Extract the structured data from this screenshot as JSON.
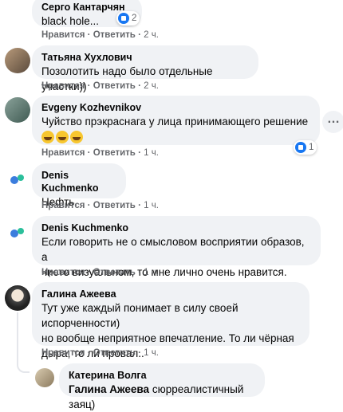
{
  "labels": {
    "like": "Нравится",
    "reply": "Ответить",
    "sep": "·"
  },
  "comments": [
    {
      "author": "Серго Кантарчян",
      "text": "black hole...",
      "time": "2 ч.",
      "reaction_count": "2"
    },
    {
      "author": "Татьяна Хухлович",
      "text": "Позолотить надо было отдельные участки))",
      "time": "2 ч."
    },
    {
      "author": "Evgeny Kozhevnikov",
      "text": "Чуйство прэкраснага у лица принимающего решение",
      "emoji": [
        "laughing-emoji",
        "laughing-emoji",
        "laughing-emoji"
      ],
      "time": "1 ч.",
      "reaction_count": "1"
    },
    {
      "author": "Denis Kuchmenko",
      "text": "Нефть.",
      "time": "1 ч."
    },
    {
      "author": "Denis Kuchmenko",
      "text_lines": [
        "Если говорить не о смысловом восприятии образов, а",
        "чисто визуальном, то мне лично очень нравится."
      ],
      "time": "1 ч."
    },
    {
      "author": "Галина Ажеева",
      "text_lines": [
        "Тут уже каждый понимает в силу своей испорченности)",
        "но вообще неприятное впечатление. То ли чёрная",
        "дыра, то ли провал.."
      ],
      "time": "1 ч."
    }
  ],
  "reply": {
    "author": "Катерина Волга",
    "mention": "Галина Ажеева",
    "text": "сюрреалистичный заяц)"
  },
  "colors": {
    "bubble": "#f0f2f5",
    "meta": "#65676b",
    "accent": "#1877f2"
  }
}
